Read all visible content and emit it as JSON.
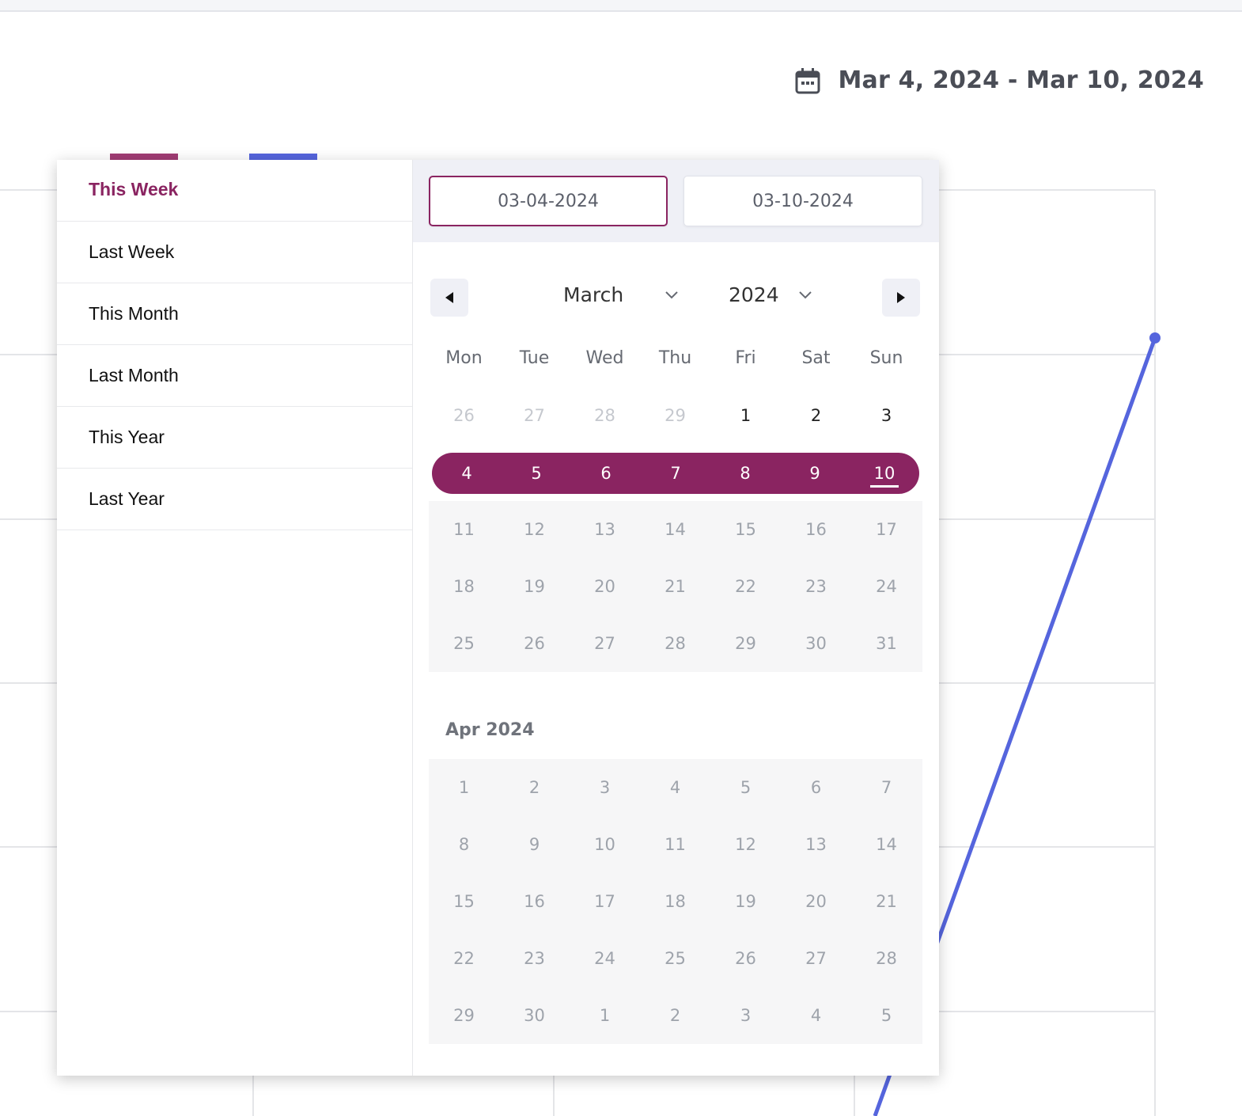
{
  "header": {
    "range_text": "Mar 4, 2024 - Mar 10, 2024"
  },
  "presets": [
    {
      "label": "This Week",
      "active": true
    },
    {
      "label": "Last Week"
    },
    {
      "label": "This Month"
    },
    {
      "label": "Last Month"
    },
    {
      "label": "This Year"
    },
    {
      "label": "Last Year"
    }
  ],
  "inputs": {
    "start": "03-04-2024",
    "end": "03-10-2024"
  },
  "calendar": {
    "month": "March",
    "year": "2024",
    "weekdays": [
      "Mon",
      "Tue",
      "Wed",
      "Thu",
      "Fri",
      "Sat",
      "Sun"
    ],
    "first_row": [
      "26",
      "27",
      "28",
      "29",
      "1",
      "2",
      "3"
    ],
    "selected_row": [
      "4",
      "5",
      "6",
      "7",
      "8",
      "9",
      "10"
    ],
    "rest_rows": [
      [
        "11",
        "12",
        "13",
        "14",
        "15",
        "16",
        "17"
      ],
      [
        "18",
        "19",
        "20",
        "21",
        "22",
        "23",
        "24"
      ],
      [
        "25",
        "26",
        "27",
        "28",
        "29",
        "30",
        "31"
      ]
    ],
    "next_month_label": "Apr 2024",
    "next_rows": [
      [
        "1",
        "2",
        "3",
        "4",
        "5",
        "6",
        "7"
      ],
      [
        "8",
        "9",
        "10",
        "11",
        "12",
        "13",
        "14"
      ],
      [
        "15",
        "16",
        "17",
        "18",
        "19",
        "20",
        "21"
      ],
      [
        "22",
        "23",
        "24",
        "25",
        "26",
        "27",
        "28"
      ],
      [
        "29",
        "30",
        "1",
        "2",
        "3",
        "4",
        "5"
      ]
    ]
  },
  "colors": {
    "accent": "#8a2461",
    "series_line": "#5565dd"
  }
}
